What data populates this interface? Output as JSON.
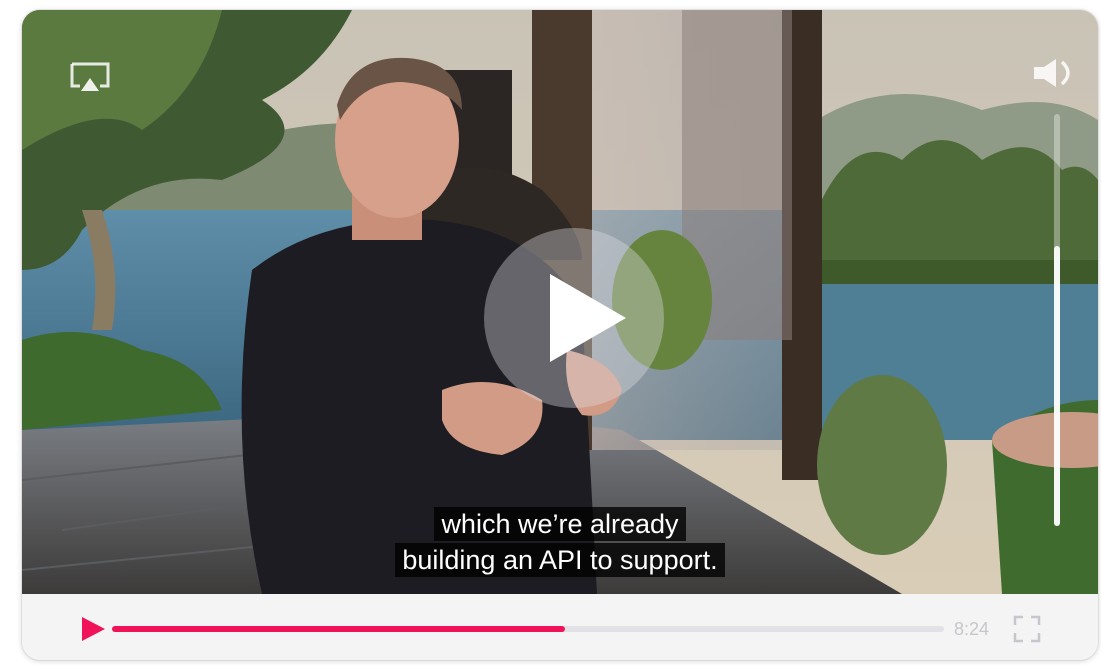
{
  "player": {
    "captions": [
      "which we’re already",
      "building an API to support."
    ],
    "time_display": "8:24",
    "progress_fraction": 0.545,
    "volume_fraction": 0.68
  },
  "colors": {
    "accent": "#f1135a",
    "control_bar": "#f4f4f4",
    "track": "#e2e2e6",
    "time_text": "#c6c6cc"
  },
  "icons": {
    "airplay": "airplay-icon",
    "volume": "speaker-volume-icon",
    "play_overlay": "play-icon",
    "play_small": "play-icon",
    "fullscreen": "fullscreen-icon"
  }
}
